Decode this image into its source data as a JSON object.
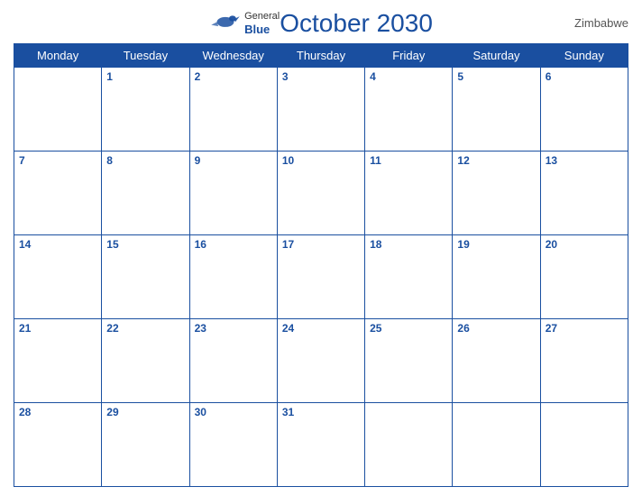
{
  "header": {
    "title": "October 2030",
    "country": "Zimbabwe",
    "logo": {
      "general": "General",
      "blue": "Blue",
      "bird_color": "#1a4fa0"
    }
  },
  "weekdays": [
    "Monday",
    "Tuesday",
    "Wednesday",
    "Thursday",
    "Friday",
    "Saturday",
    "Sunday"
  ],
  "weeks": [
    [
      "",
      "1",
      "2",
      "3",
      "4",
      "5",
      "6"
    ],
    [
      "7",
      "8",
      "9",
      "10",
      "11",
      "12",
      "13"
    ],
    [
      "14",
      "15",
      "16",
      "17",
      "18",
      "19",
      "20"
    ],
    [
      "21",
      "22",
      "23",
      "24",
      "25",
      "26",
      "27"
    ],
    [
      "28",
      "29",
      "30",
      "31",
      "",
      "",
      ""
    ]
  ],
  "colors": {
    "header_bg": "#1a4fa0",
    "header_text": "#ffffff",
    "day_number": "#1a4fa0",
    "border": "#1a4fa0"
  }
}
